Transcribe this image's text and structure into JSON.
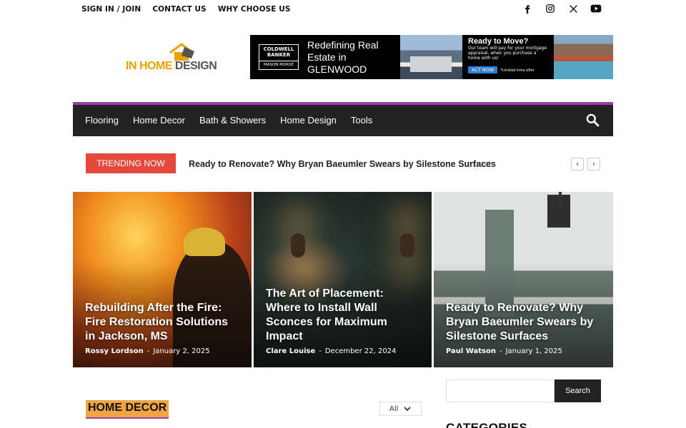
{
  "top_links": [
    "SIGN IN / JOIN",
    "CONTACT US",
    "WHY CHOOSE US"
  ],
  "social_icons": [
    "facebook-icon",
    "instagram-icon",
    "x-icon",
    "youtube-icon"
  ],
  "logo": {
    "part1": "IN HOME",
    "part2": "DESIGN"
  },
  "ad": {
    "brand_top": "COLDWELL BANKER",
    "brand_bottom": "MASON MORSE",
    "headline": "Redefining Real Estate in GLENWOOD",
    "move_title": "Ready to Move?",
    "move_body": "Our team will pay for your mortgage appraisal, when you purchase a home with us!",
    "cta": "ACT NOW",
    "note": "*Limited-time offer"
  },
  "nav": [
    "Flooring",
    "Home Decor",
    "Bath & Showers",
    "Home Design",
    "Tools"
  ],
  "trending": {
    "label": "TRENDING NOW",
    "headline": "Ready to Renovate? Why Bryan Baeumler Swears by Silestone Surfaces",
    "ghost": "mpact"
  },
  "features": [
    {
      "title": "Rebuilding After the Fire: Fire Restoration Solutions in Jackson, MS",
      "author": "Rossy Lordson",
      "date": "January 2, 2025"
    },
    {
      "title": "The Art of Placement: Where to Install Wall Sconces for Maximum Impact",
      "author": "Clare Louise",
      "date": "December 22, 2024"
    },
    {
      "title": "Ready to Renovate? Why Bryan Baeumler Swears by Silestone Surfaces",
      "author": "Paul Watson",
      "date": "January 1, 2025"
    }
  ],
  "section": {
    "title": "HOME DECOR",
    "filter": "All"
  },
  "sidebar": {
    "search_button": "Search",
    "categories_title": "CATEGORIES"
  },
  "colors": {
    "accent": "#9b3db0",
    "trending": "#e5483d",
    "section_bg": "#f0a545",
    "logo": "#e8a200"
  }
}
